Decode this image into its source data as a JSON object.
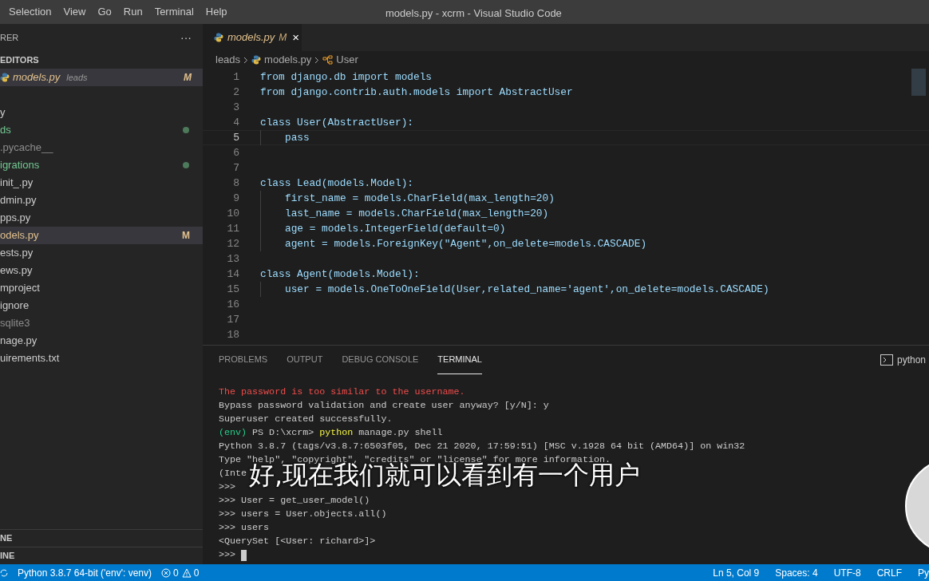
{
  "title_bar": {
    "menu": [
      "Selection",
      "View",
      "Go",
      "Run",
      "Terminal",
      "Help"
    ],
    "title": "models.py - xcrm - Visual Studio Code"
  },
  "sidebar": {
    "header": "RER",
    "more": "···",
    "open_editors": {
      "label": "EDITORS",
      "items": [
        {
          "name": "models.py",
          "folder": "leads",
          "badge": "M",
          "selected": true
        }
      ]
    },
    "files": [
      {
        "name": "y",
        "dot": false,
        "ignored": false,
        "selected": false
      },
      {
        "name": "ds",
        "dot": true,
        "ignored": false,
        "selected": false
      },
      {
        "name": ".pycache__",
        "dot": false,
        "ignored": true,
        "selected": false
      },
      {
        "name": "igrations",
        "dot": true,
        "ignored": false,
        "selected": false
      },
      {
        "name": "init_.py",
        "dot": false,
        "ignored": false,
        "selected": false
      },
      {
        "name": "dmin.py",
        "dot": false,
        "ignored": false,
        "selected": false
      },
      {
        "name": "pps.py",
        "dot": false,
        "ignored": false,
        "selected": false
      },
      {
        "name": "odels.py",
        "dot": false,
        "ignored": false,
        "badge": "M",
        "selected": true
      },
      {
        "name": "ests.py",
        "dot": false,
        "ignored": false,
        "selected": false
      },
      {
        "name": "ews.py",
        "dot": false,
        "ignored": false,
        "selected": false
      },
      {
        "name": "mproject",
        "dot": false,
        "ignored": false,
        "selected": false
      },
      {
        "name": "ignore",
        "dot": false,
        "ignored": false,
        "selected": false
      },
      {
        "name": "sqlite3",
        "dot": false,
        "ignored": true,
        "selected": false
      },
      {
        "name": "nage.py",
        "dot": false,
        "ignored": false,
        "selected": false
      },
      {
        "name": "uirements.txt",
        "dot": false,
        "ignored": false,
        "selected": false
      }
    ],
    "bottom_sections": [
      "NE",
      "INE"
    ]
  },
  "editor": {
    "tab": {
      "name": "models.py",
      "badge": "M",
      "close": "×"
    },
    "breadcrumb": [
      "leads",
      "models.py",
      "User"
    ],
    "lines": [
      {
        "n": "1",
        "active": false,
        "text": "from django.db import models"
      },
      {
        "n": "2",
        "active": false,
        "text": "from django.contrib.auth.models import AbstractUser"
      },
      {
        "n": "3",
        "active": false
      },
      {
        "n": "4",
        "active": false,
        "text": "class User(AbstractUser):"
      },
      {
        "n": "5",
        "active": true,
        "text": "pass",
        "indented": true
      },
      {
        "n": "6",
        "active": false
      },
      {
        "n": "7",
        "active": false
      },
      {
        "n": "8",
        "active": false,
        "text": "class Lead(models.Model):"
      },
      {
        "n": "9",
        "active": false,
        "text": "first_name = models.CharField(max_length=20)",
        "indented": true
      },
      {
        "n": "10",
        "active": false,
        "text": "last_name = models.CharField(max_length=20)",
        "indented": true
      },
      {
        "n": "11",
        "active": false,
        "text": "age = models.IntegerField(default=0)",
        "indented": true
      },
      {
        "n": "12",
        "active": false,
        "text": "agent = models.ForeignKey(\"Agent\",on_delete=models.CASCADE)",
        "indented": true
      },
      {
        "n": "13",
        "active": false
      },
      {
        "n": "14",
        "active": false,
        "text": "class Agent(models.Model):"
      },
      {
        "n": "15",
        "active": false,
        "text": "user = models.OneToOneField(User,related_name='agent',on_delete=models.CASCADE)",
        "indented": true
      },
      {
        "n": "16",
        "active": false
      },
      {
        "n": "17",
        "active": false
      },
      {
        "n": "18",
        "active": false
      }
    ]
  },
  "panel": {
    "tabs": [
      {
        "label": "PROBLEMS",
        "selected": false
      },
      {
        "label": "OUTPUT",
        "selected": false
      },
      {
        "label": "DEBUG CONSOLE",
        "selected": false
      },
      {
        "label": "TERMINAL",
        "selected": true
      }
    ],
    "shell": "python",
    "terminal_lines": [
      {
        "kind": "error",
        "text": "The password is too similar to the username."
      },
      {
        "kind": "output",
        "text": "Bypass password validation and create user anyway? [y/N]: y"
      },
      {
        "kind": "output",
        "text": "Superuser created successfully."
      },
      {
        "kind": "prompt",
        "env": "(env)",
        "path": "PS D:\\xcrm>",
        "command": "python",
        "args": "manage.py shell"
      },
      {
        "kind": "output",
        "text": "Python 3.8.7 (tags/v3.8.7:6503f05, Dec 21 2020, 17:59:51) [MSC v.1928 64 bit (AMD64)] on win32"
      },
      {
        "kind": "output",
        "text": "Type \"help\", \"copyright\", \"credits\" or \"license\" for more information."
      },
      {
        "kind": "output",
        "text": "(Inte"
      },
      {
        "kind": "output",
        "text": ">>>"
      },
      {
        "kind": "output",
        "text": ">>> User = get_user_model()"
      },
      {
        "kind": "output",
        "text": ">>> users = User.objects.all()"
      },
      {
        "kind": "output",
        "text": ">>> users"
      },
      {
        "kind": "output",
        "text": "<QuerySet [<User: richard>]>"
      },
      {
        "kind": "output",
        "text": ">>>"
      }
    ]
  },
  "subtitle": "好,现在我们就可以看到有一个用户",
  "status_bar": {
    "interpreter": "Python 3.8.7 64-bit ('env': venv)",
    "errors": "0",
    "warnings": "0",
    "right": [
      "Ln 5, Col 9",
      "Spaces: 4",
      "UTF-8",
      "CRLF",
      "Py"
    ]
  }
}
